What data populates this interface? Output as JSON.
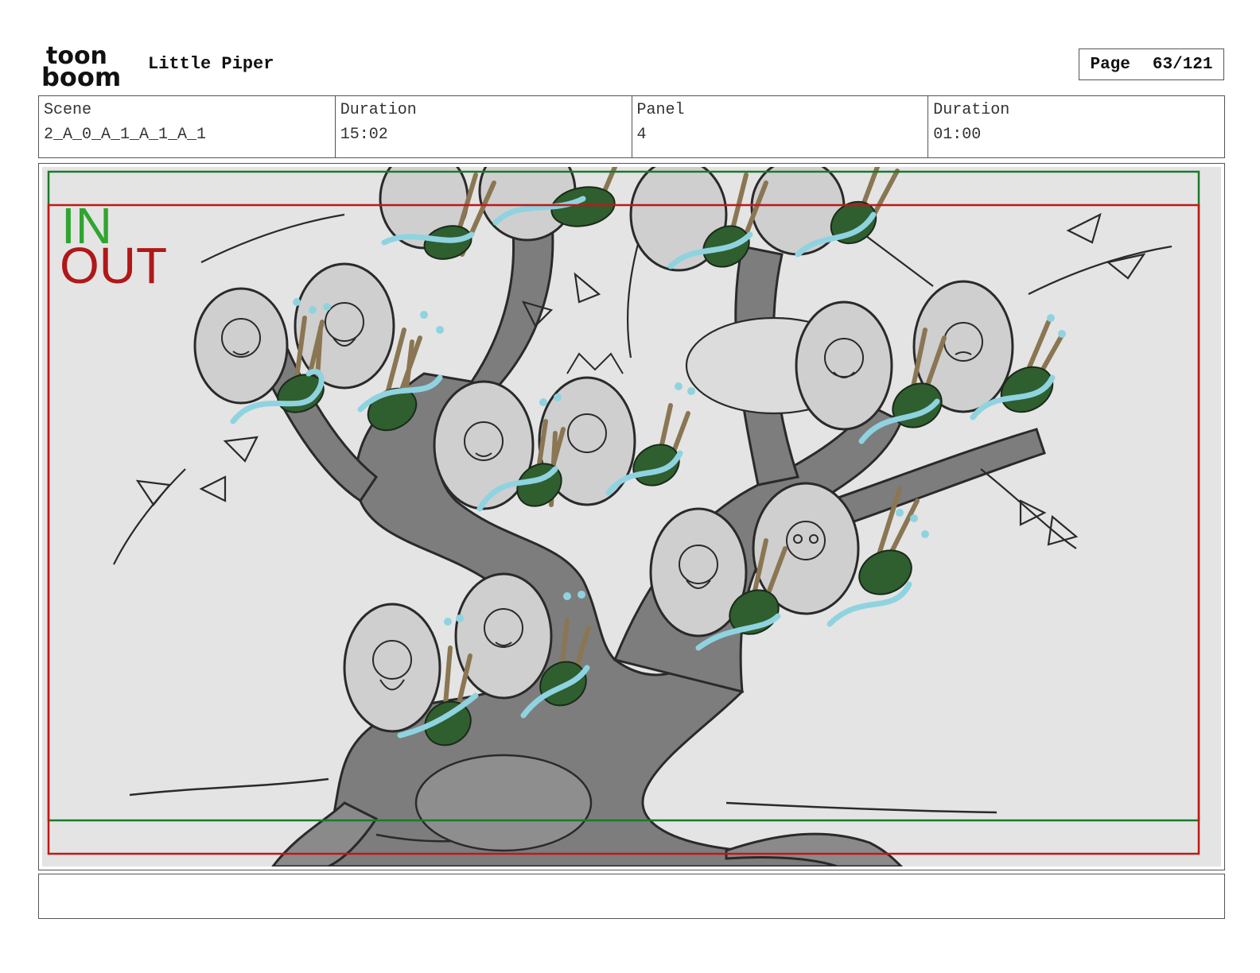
{
  "header": {
    "logo_top": "toon",
    "logo_bottom": "boom",
    "project_title": "Little Piper",
    "page_label": "Page",
    "page_number": "63/121"
  },
  "info": {
    "scene_label": "Scene",
    "scene_value": "2_A_0_A_1_A_1_A_1",
    "scene_duration_label": "Duration",
    "scene_duration_value": "15:02",
    "panel_label": "Panel",
    "panel_value": "4",
    "panel_duration_label": "Duration",
    "panel_duration_value": "01:00"
  },
  "panel": {
    "in_label": "IN",
    "out_label": "OUT",
    "colors": {
      "in_frame": "#1a7a2a",
      "out_frame": "#c01818",
      "background": "#e4e4e4",
      "trunk": "#7d7d7d",
      "leaf_green": "#2f5e2f",
      "stem_brown": "#8a7652",
      "water_blue": "#8fd3e0"
    }
  },
  "notes": {
    "text": ""
  }
}
